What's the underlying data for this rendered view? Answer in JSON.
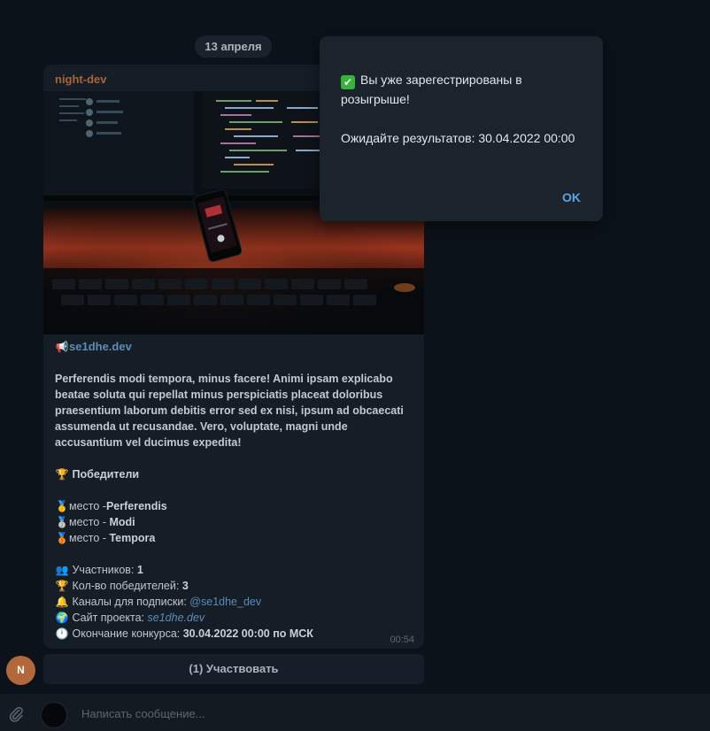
{
  "date_separator": "13 апреля",
  "message": {
    "sender": "night-dev",
    "link_icon": "📢",
    "link_title": "se1dhe.dev",
    "paragraph": "Perferendis modi tempora, minus facere! Animi ipsam explicabo beatae soluta qui repellat minus perspiciatis placeat doloribus praesentium laborum debitis error sed ex nisi, ipsum ad obcaecati assumenda ut recusandae. Vero, voluptate, magni unde accusantium vel ducimus expedita!",
    "winners_icon": "🏆",
    "winners_heading": "Победители",
    "places": [
      {
        "icon": "🥇",
        "prefix": "место -",
        "name": "Perferendis"
      },
      {
        "icon": "🥈",
        "prefix": "место - ",
        "name": "Modi"
      },
      {
        "icon": "🥉",
        "prefix": "место - ",
        "name": "Tempora"
      }
    ],
    "stats": {
      "participants_icon": "👥",
      "participants_label": "Участников: ",
      "participants_value": "1",
      "winners_count_icon": "🏆",
      "winners_count_label": "Кол-во победителей: ",
      "winners_count_value": "3",
      "channels_icon": "🔔",
      "channels_label": "Каналы для подписки: ",
      "channels_value": "@se1dhe_dev",
      "site_icon": "🌍",
      "site_label": "Сайт проекта: ",
      "site_value": "se1dhe.dev",
      "end_icon": "🕛",
      "end_label": "Окончание конкурса: ",
      "end_value": "30.04.2022 00:00  по МСК"
    },
    "time": "00:54"
  },
  "participate_button": "(1) Участвовать",
  "avatar_letter": "N",
  "composer_placeholder": "Написать сообщение...",
  "popup": {
    "check_icon": "✔",
    "line1": "Вы уже зарегестрированы в розыгрыше!",
    "line2": "Ожидайте результатов: 30.04.2022 00:00",
    "ok": "OK"
  },
  "colors": {
    "accent": "#5aa4e6",
    "sender": "#a8633a",
    "avatar": "#b2683b",
    "check": "#34b53a"
  }
}
